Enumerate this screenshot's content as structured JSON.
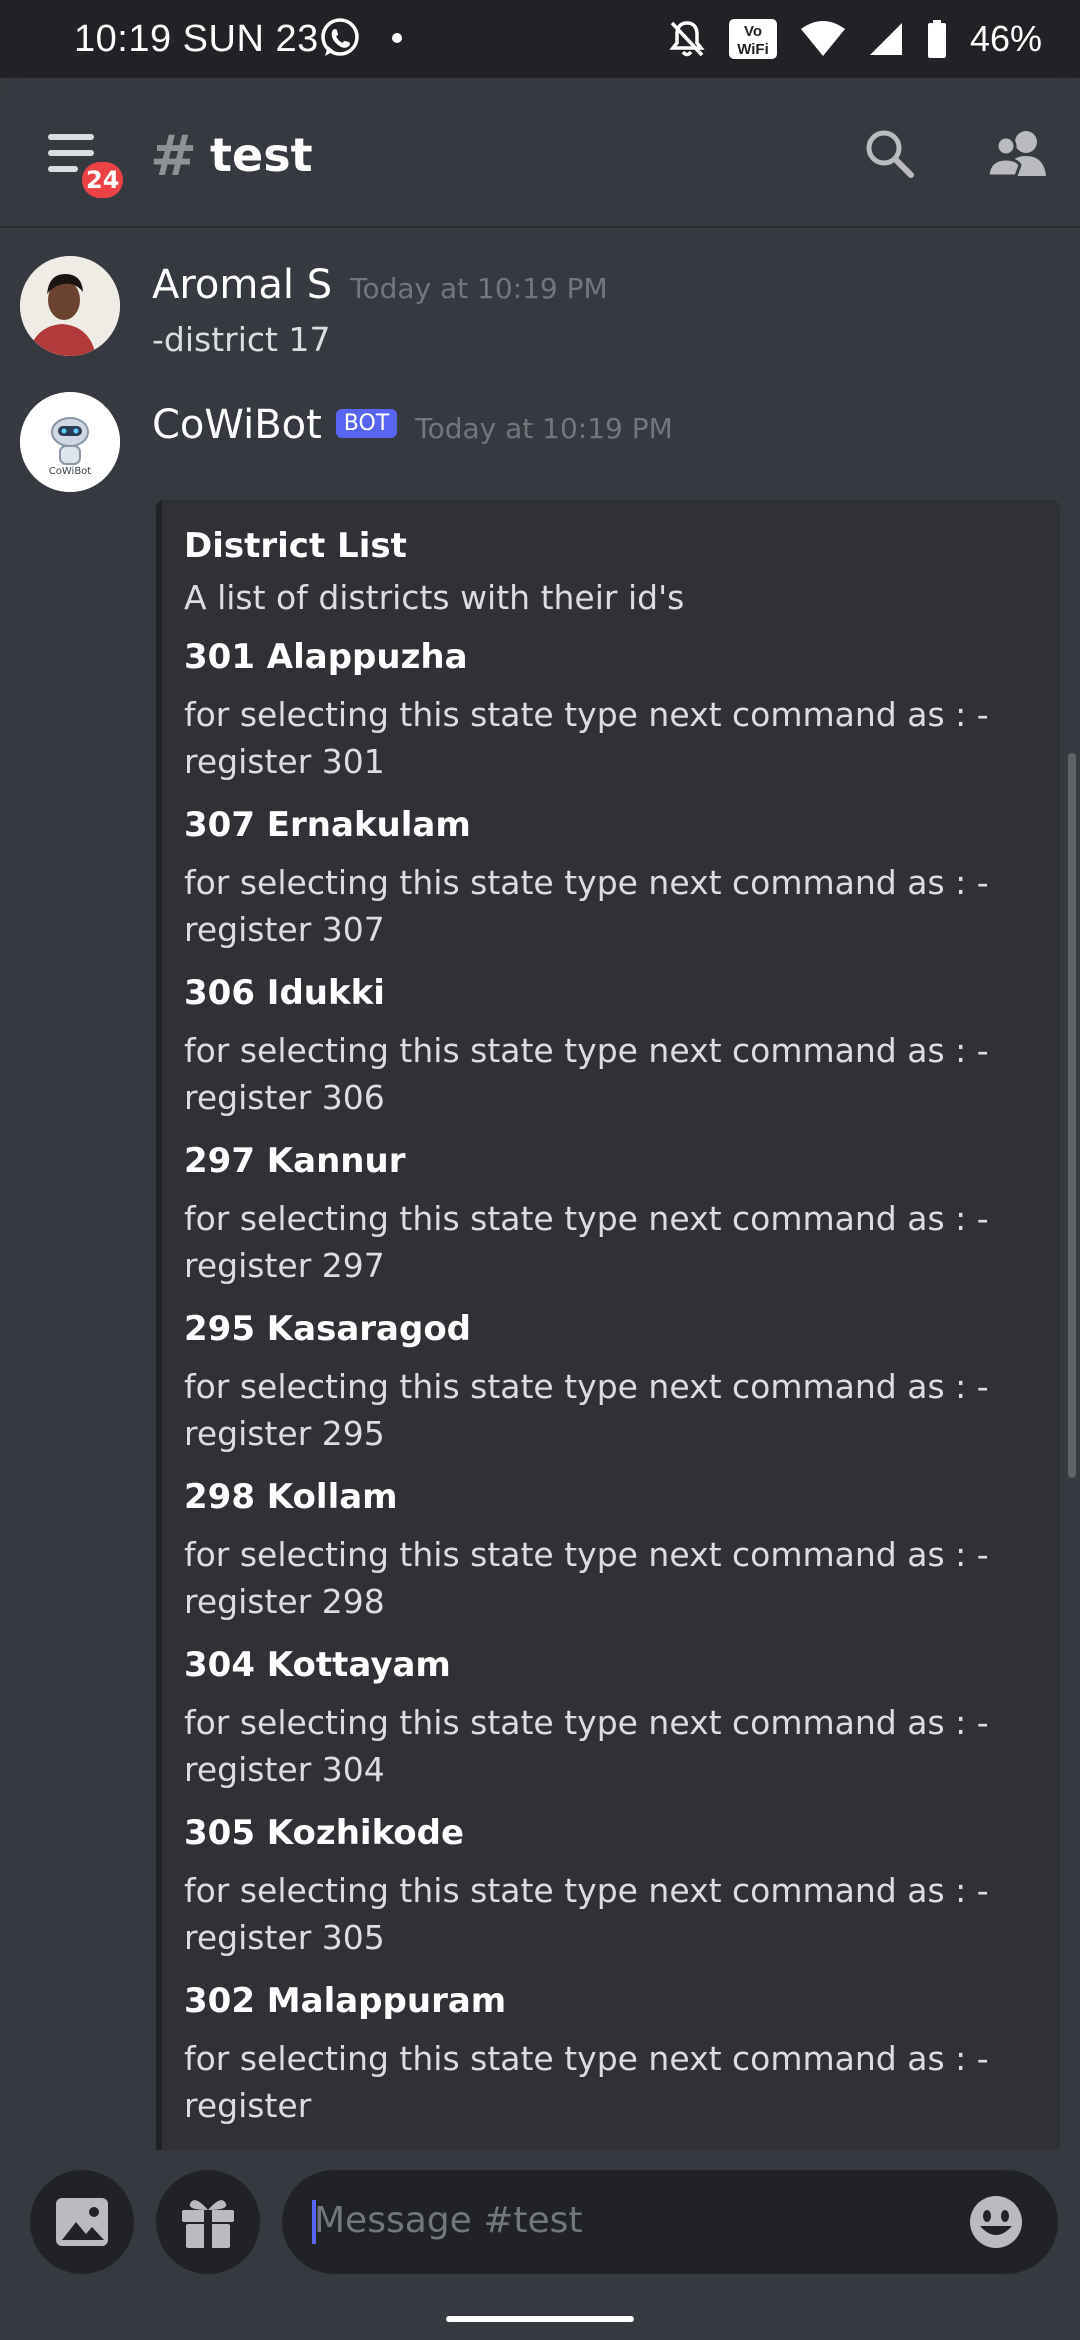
{
  "status_bar": {
    "time": "10:19 SUN 23",
    "battery": "46%",
    "icons": [
      "whatsapp-icon",
      "notifications-off-icon",
      "vowifi-icon",
      "wifi-icon",
      "signal-icon",
      "battery-icon"
    ],
    "vowifi_top": "Vo",
    "vowifi_bottom": "WiFi"
  },
  "header": {
    "notification_badge": "24",
    "channel_prefix": "#",
    "channel_name": "test"
  },
  "messages": [
    {
      "author": "Aromal S",
      "timestamp": "Today at 10:19 PM",
      "text": "-district 17"
    },
    {
      "author": "CoWiBot",
      "tag": "BOT",
      "timestamp": "Today at 10:19 PM",
      "avatar_caption": "CoWiBot",
      "embed": {
        "title": "District List",
        "description": "A list of districts with their id's",
        "fields": [
          {
            "name": "301  Alappuzha",
            "value": "for selecting this state type next command as : -register 301"
          },
          {
            "name": "307  Ernakulam",
            "value": "for selecting this state type next command as : -register 307"
          },
          {
            "name": "306  Idukki",
            "value": "for selecting this state type next command as : -register 306"
          },
          {
            "name": "297  Kannur",
            "value": "for selecting this state type next command as : -register 297"
          },
          {
            "name": "295  Kasaragod",
            "value": "for selecting this state type next command as : -register 295"
          },
          {
            "name": "298  Kollam",
            "value": "for selecting this state type next command as : -register 298"
          },
          {
            "name": "304  Kottayam",
            "value": "for selecting this state type next command as : -register 304"
          },
          {
            "name": "305  Kozhikode",
            "value": "for selecting this state type next command as : -register 305"
          },
          {
            "name": "302  Malappuram",
            "value": "for selecting this state type next command as : -register"
          }
        ]
      }
    }
  ],
  "composer": {
    "placeholder": "Message #test"
  },
  "colors": {
    "background": "#36393f",
    "status_bar": "#202225",
    "embed_background": "#2f3136",
    "bot_tag": "#5865f2",
    "badge": "#ed4245"
  }
}
